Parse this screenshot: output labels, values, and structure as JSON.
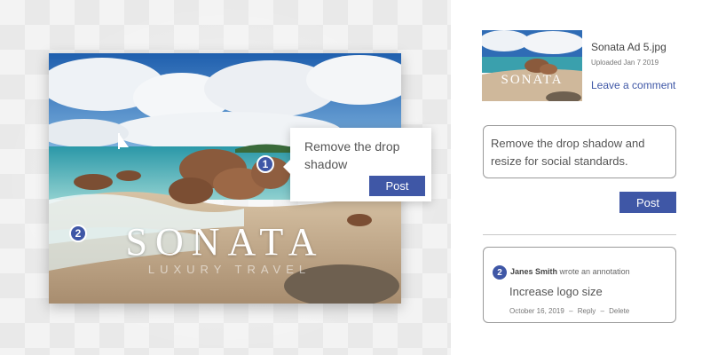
{
  "preview": {
    "brand_title": "SONATA",
    "brand_subtitle": "LUXURY TRAVEL",
    "markers": [
      "1",
      "2"
    ]
  },
  "popup": {
    "text": "Remove the drop shadow",
    "post_label": "Post"
  },
  "file": {
    "thumb_title": "SONATA",
    "name": "Sonata Ad 5.jpg",
    "uploaded": "Uploaded Jan 7 2019",
    "leave_comment": "Leave a comment"
  },
  "comment": {
    "value": "Remove the drop shadow and resize for social standards.",
    "post_label": "Post"
  },
  "annotation": {
    "marker": "2",
    "author": "Janes Smith",
    "action": "wrote an annotation",
    "body": "Increase logo size",
    "date": "October 16, 2019",
    "separator": "–",
    "reply": "Reply",
    "delete": "Delete"
  },
  "colors": {
    "accent": "#3f57a6"
  }
}
